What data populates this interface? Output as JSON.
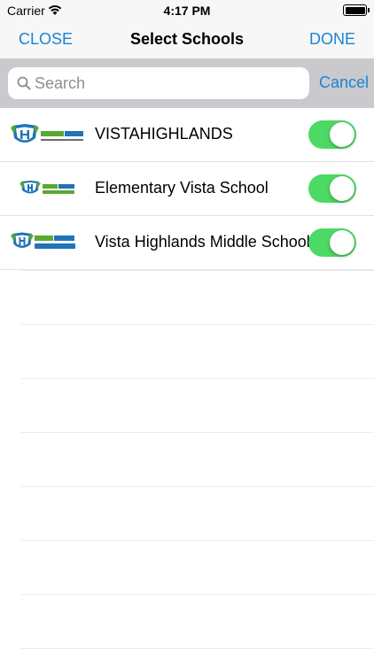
{
  "status_bar": {
    "carrier": "Carrier",
    "time": "4:17 PM"
  },
  "nav": {
    "close_label": "CLOSE",
    "title": "Select Schools",
    "done_label": "DONE"
  },
  "search": {
    "placeholder": "Search",
    "value": "",
    "cancel_label": "Cancel"
  },
  "schools": [
    {
      "name": "VISTAHIGHLANDS",
      "enabled": true
    },
    {
      "name": "Elementary Vista School",
      "enabled": true
    },
    {
      "name": "Vista Highlands Middle School",
      "enabled": true
    }
  ],
  "colors": {
    "accent": "#1a84d6",
    "toggle_on": "#4cd964",
    "logo_green": "#5aa832",
    "logo_blue": "#1f73b7"
  }
}
